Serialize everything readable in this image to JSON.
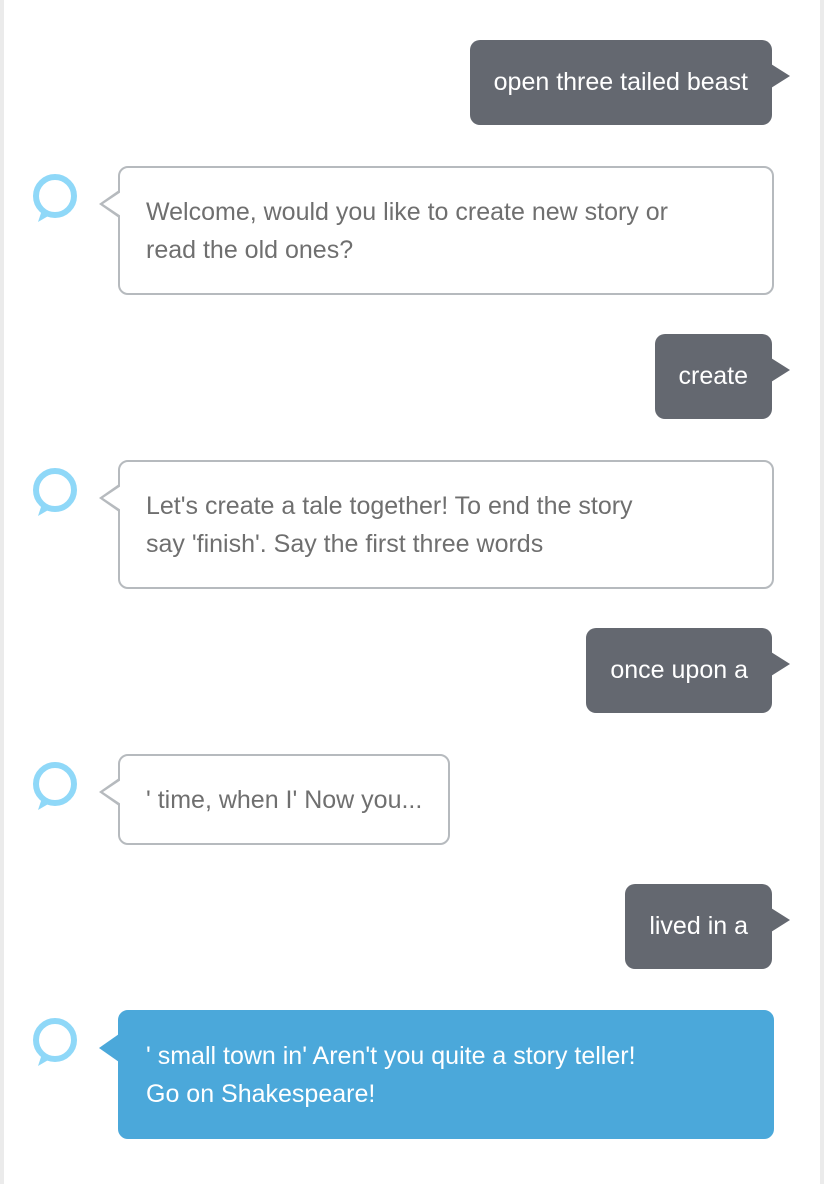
{
  "colors": {
    "user_bubble": "#646870",
    "alexa_border": "#b6babe",
    "alexa_text": "#6f6f6f",
    "highlight_bubble": "#4ba8da",
    "alexa_icon": "#8fd8f8"
  },
  "icons": {
    "alexa": "alexa-ring-icon"
  },
  "messages": [
    {
      "speaker": "user",
      "text": "open three tailed beast"
    },
    {
      "speaker": "alexa",
      "text": "Welcome, would you like to create new story or\nread the old ones?"
    },
    {
      "speaker": "user",
      "text": "create"
    },
    {
      "speaker": "alexa",
      "text": "Let's create a tale together! To end the story\nsay 'finish'. Say the first three words"
    },
    {
      "speaker": "user",
      "text": "once upon a"
    },
    {
      "speaker": "alexa",
      "text": "' time, when I' Now you..."
    },
    {
      "speaker": "user",
      "text": "lived in a"
    },
    {
      "speaker": "alexa",
      "text": "' small town in' Aren't you quite a story teller!\nGo on Shakespeare!",
      "highlighted": true
    }
  ]
}
